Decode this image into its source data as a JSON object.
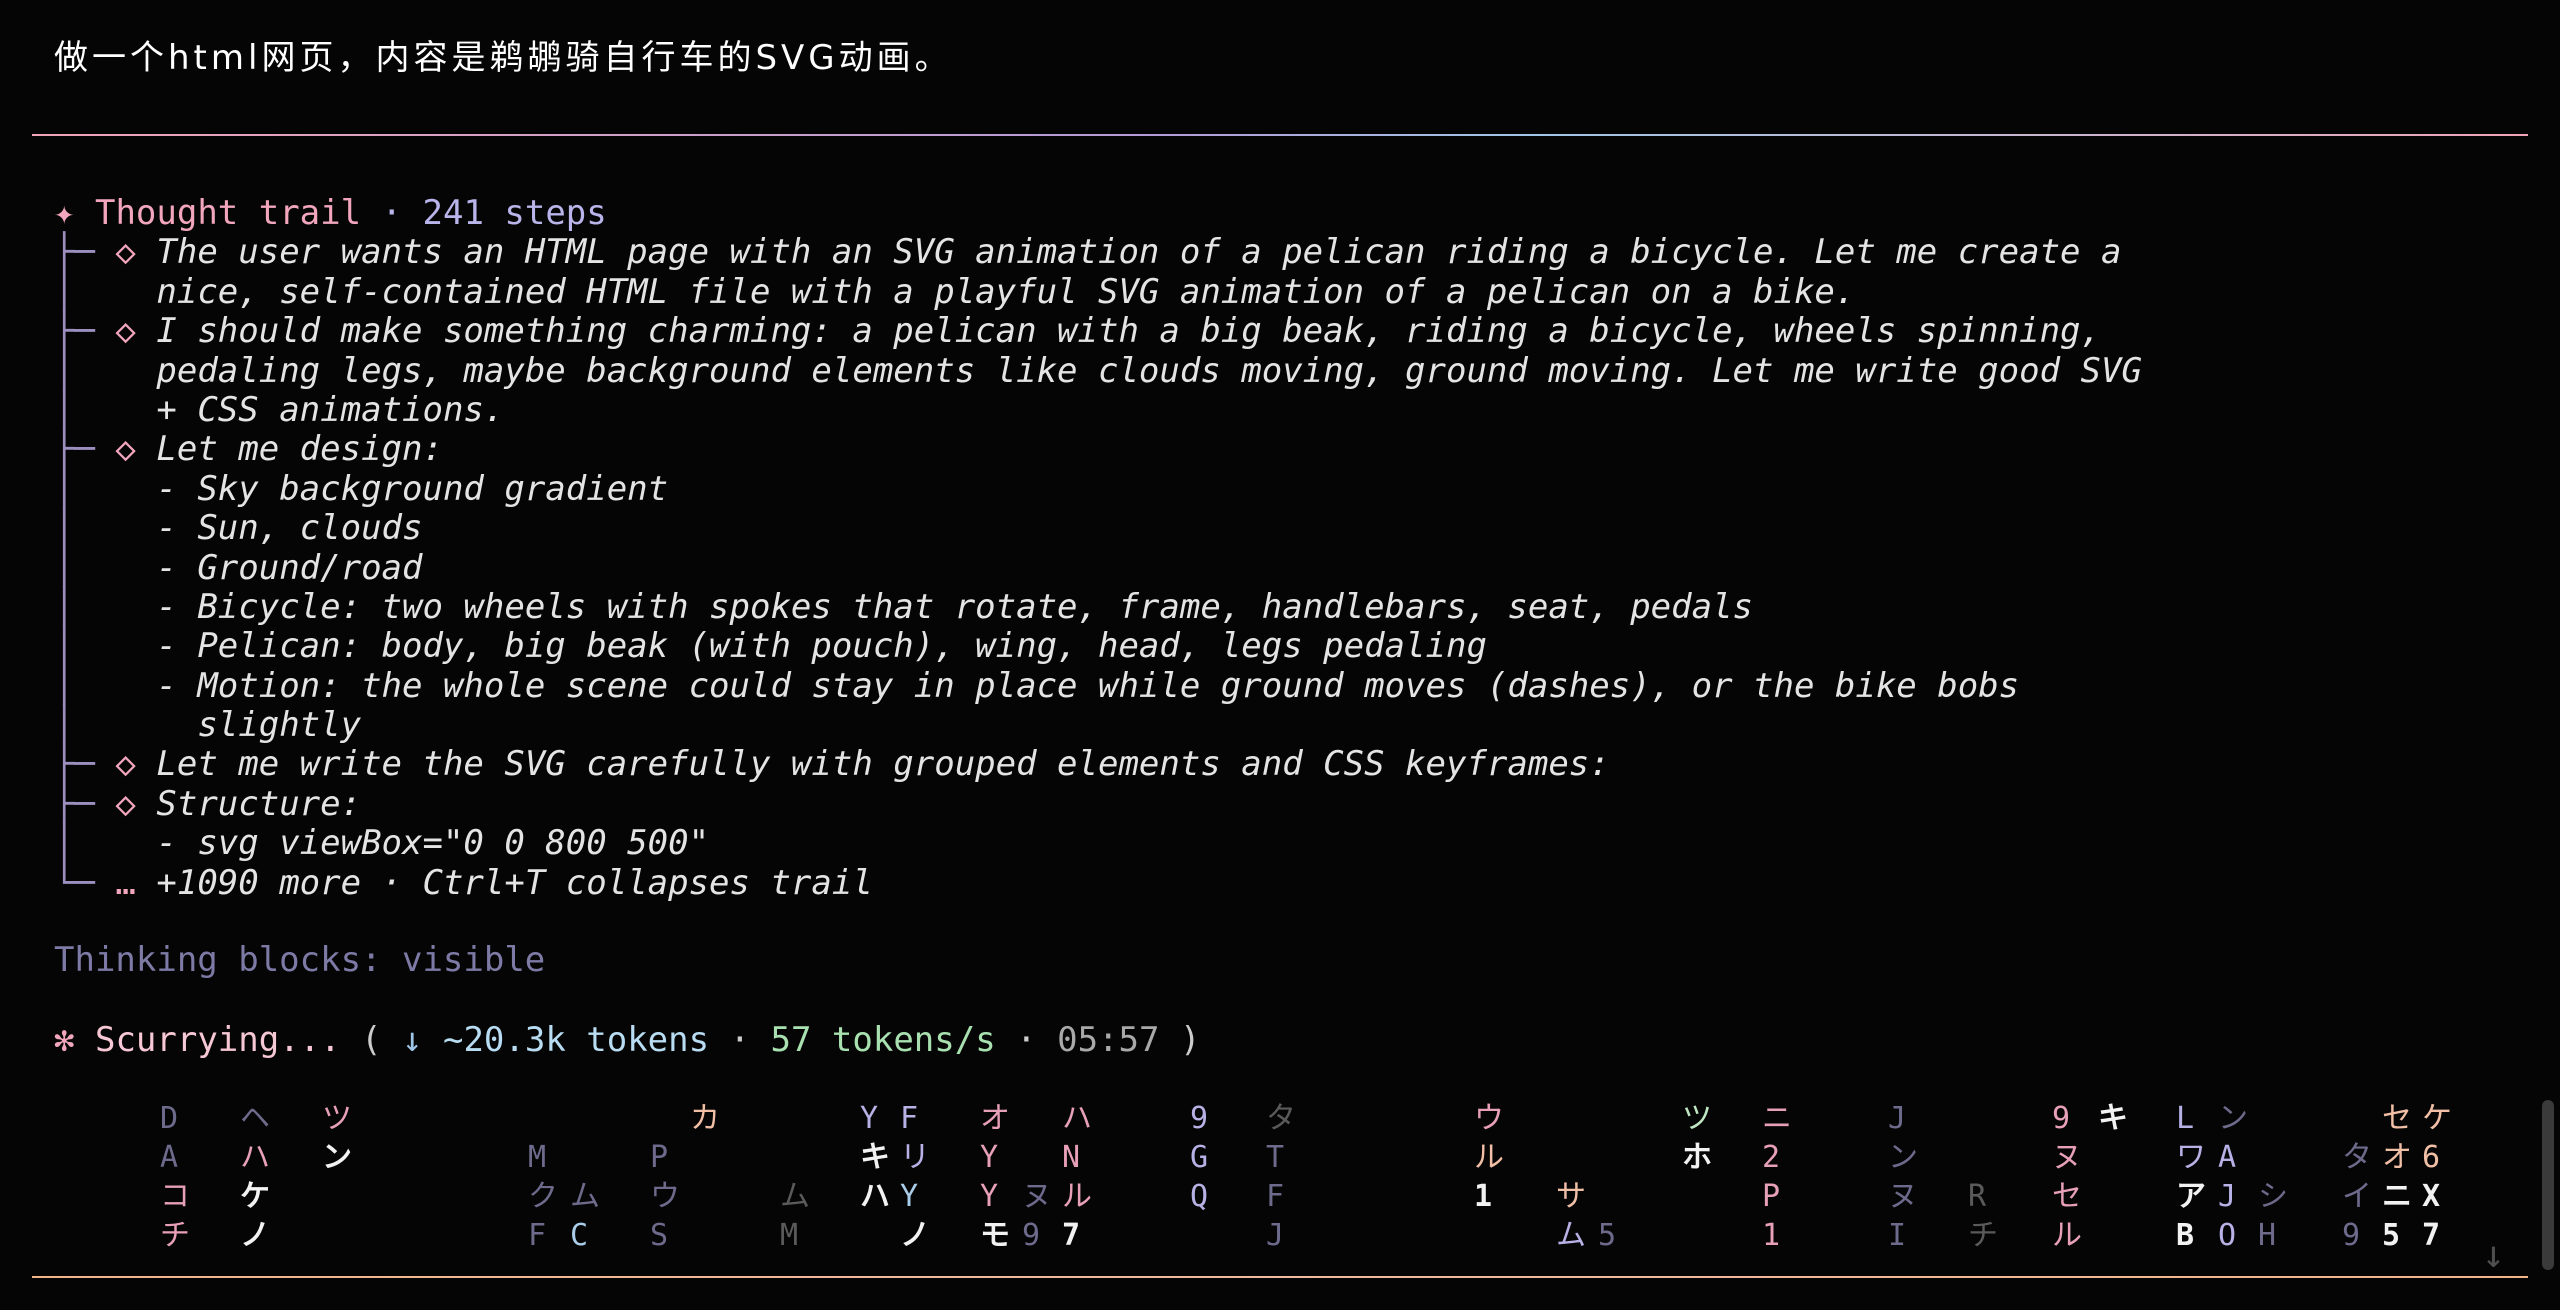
{
  "prompt": "做一个html网页，内容是鹈鹕骑自行车的SVG动画。",
  "trail": {
    "star": "✦",
    "title": "Thought trail",
    "sep": " · ",
    "count": "241 steps",
    "lines": [
      {
        "prefix": "├─ ",
        "marker": "◇ ",
        "text": "The user wants an HTML page with an SVG animation of a pelican riding a bicycle. Let me create a"
      },
      {
        "prefix": "│  ",
        "marker": "  ",
        "text": "nice, self-contained HTML file with a playful SVG animation of a pelican on a bike."
      },
      {
        "prefix": "├─ ",
        "marker": "◇ ",
        "text": "I should make something charming: a pelican with a big beak, riding a bicycle, wheels spinning,"
      },
      {
        "prefix": "│  ",
        "marker": "  ",
        "text": "pedaling legs, maybe background elements like clouds moving, ground moving. Let me write good SVG"
      },
      {
        "prefix": "│  ",
        "marker": "  ",
        "text": "+ CSS animations."
      },
      {
        "prefix": "├─ ",
        "marker": "◇ ",
        "text": "Let me design:"
      },
      {
        "prefix": "│  ",
        "marker": "  ",
        "text": "- Sky background gradient"
      },
      {
        "prefix": "│  ",
        "marker": "  ",
        "text": "- Sun, clouds"
      },
      {
        "prefix": "│  ",
        "marker": "  ",
        "text": "- Ground/road"
      },
      {
        "prefix": "│  ",
        "marker": "  ",
        "text": "- Bicycle: two wheels with spokes that rotate, frame, handlebars, seat, pedals"
      },
      {
        "prefix": "│  ",
        "marker": "  ",
        "text": "- Pelican: body, big beak (with pouch), wing, head, legs pedaling"
      },
      {
        "prefix": "│  ",
        "marker": "  ",
        "text": "- Motion: the whole scene could stay in place while ground moves (dashes), or the bike bobs"
      },
      {
        "prefix": "│  ",
        "marker": "  ",
        "text": "  slightly"
      },
      {
        "prefix": "├─ ",
        "marker": "◇ ",
        "text": "Let me write the SVG carefully with grouped elements and CSS keyframes:"
      },
      {
        "prefix": "├─ ",
        "marker": "◇ ",
        "text": "Structure:"
      },
      {
        "prefix": "│  ",
        "marker": "  ",
        "text": "- svg viewBox=\"0 0 800 500\""
      },
      {
        "prefix": "└─ ",
        "marker": "… ",
        "text": "+1090 more · Ctrl+T collapses trail"
      }
    ]
  },
  "thinking": "Thinking blocks: visible",
  "status": {
    "spinner": "✻",
    "label": "Scurrying...",
    "open": " ( ",
    "arrow": "↓",
    "tokens": " ~20.3k tokens",
    "dot": " · ",
    "rate": "57 tokens/s",
    "time": "05:57",
    "close": " )"
  },
  "rain_colors": {
    "dim": "#6d6a8c",
    "pink": "#e7a0b8",
    "lav": "#b7b1e6",
    "blue": "#a9cde8",
    "white": "#f2f2f2",
    "grey": "#5a5a5a",
    "peach": "#f1bfa6",
    "green": "#bfe6c2"
  },
  "rain": [
    {
      "ch": "D",
      "c": "dim"
    },
    {
      "ch": "A",
      "c": "dim"
    },
    {
      "ch": "コ",
      "c": "pink"
    },
    {
      "ch": "チ",
      "c": "pink"
    },
    {
      "ch": "ヘ",
      "c": "dim"
    },
    {
      "ch": "ハ",
      "c": "pink"
    },
    {
      "ch": "ケ",
      "c": "white"
    },
    {
      "ch": "ノ",
      "c": "white"
    },
    {
      "ch": "ツ",
      "c": "pink"
    },
    {
      "ch": "ン",
      "c": "white"
    },
    {
      "ch": "M",
      "c": "dim"
    },
    {
      "ch": "ク",
      "c": "dim"
    },
    {
      "ch": "F",
      "c": "dim"
    },
    {
      "ch": "ム",
      "c": "dim"
    },
    {
      "ch": "C",
      "c": "blue"
    },
    {
      "ch": "P",
      "c": "dim"
    },
    {
      "ch": "ウ",
      "c": "dim"
    },
    {
      "ch": "S",
      "c": "dim"
    },
    {
      "ch": "カ",
      "c": "peach"
    },
    {
      "ch": "ム",
      "c": "grey"
    },
    {
      "ch": "M",
      "c": "grey"
    },
    {
      "ch": "Y",
      "c": "lav"
    },
    {
      "ch": "キ",
      "c": "white"
    },
    {
      "ch": "ハ",
      "c": "white"
    },
    {
      "ch": "F",
      "c": "lav"
    },
    {
      "ch": "リ",
      "c": "lav"
    },
    {
      "ch": "Y",
      "c": "blue"
    },
    {
      "ch": "ノ",
      "c": "white"
    },
    {
      "ch": "オ",
      "c": "pink"
    },
    {
      "ch": "Y",
      "c": "pink"
    },
    {
      "ch": "Y",
      "c": "pink"
    },
    {
      "ch": "モ",
      "c": "white"
    },
    {
      "ch": "ヌ",
      "c": "dim"
    },
    {
      "ch": "9",
      "c": "dim"
    },
    {
      "ch": "ハ",
      "c": "pink"
    },
    {
      "ch": "N",
      "c": "pink"
    },
    {
      "ch": "ル",
      "c": "pink"
    },
    {
      "ch": "7",
      "c": "white"
    },
    {
      "ch": "9",
      "c": "lav"
    },
    {
      "ch": "G",
      "c": "lav"
    },
    {
      "ch": "Q",
      "c": "lav"
    },
    {
      "ch": "タ",
      "c": "grey"
    },
    {
      "ch": "T",
      "c": "dim"
    },
    {
      "ch": "F",
      "c": "dim"
    },
    {
      "ch": "J",
      "c": "dim"
    },
    {
      "ch": "ウ",
      "c": "pink"
    },
    {
      "ch": "ル",
      "c": "peach"
    },
    {
      "ch": "1",
      "c": "white"
    },
    {
      "ch": "サ",
      "c": "peach"
    },
    {
      "ch": "ム",
      "c": "lav"
    },
    {
      "ch": "5",
      "c": "dim"
    },
    {
      "ch": "ツ",
      "c": "green"
    },
    {
      "ch": "ホ",
      "c": "white"
    },
    {
      "ch": "ニ",
      "c": "pink"
    },
    {
      "ch": "2",
      "c": "pink"
    },
    {
      "ch": "P",
      "c": "pink"
    },
    {
      "ch": "1",
      "c": "pink"
    },
    {
      "ch": "J",
      "c": "dim"
    },
    {
      "ch": "ン",
      "c": "dim"
    },
    {
      "ch": "ヌ",
      "c": "dim"
    },
    {
      "ch": "I",
      "c": "dim"
    },
    {
      "ch": "R",
      "c": "grey"
    },
    {
      "ch": "チ",
      "c": "grey"
    },
    {
      "ch": "9",
      "c": "pink"
    },
    {
      "ch": "ヌ",
      "c": "pink"
    },
    {
      "ch": "セ",
      "c": "pink"
    },
    {
      "ch": "ル",
      "c": "pink"
    },
    {
      "ch": "キ",
      "c": "white"
    },
    {
      "ch": "L",
      "c": "lav"
    },
    {
      "ch": "ワ",
      "c": "lav"
    },
    {
      "ch": "ア",
      "c": "white"
    },
    {
      "ch": "B",
      "c": "white"
    },
    {
      "ch": "ン",
      "c": "dim"
    },
    {
      "ch": "A",
      "c": "lav"
    },
    {
      "ch": "J",
      "c": "lav"
    },
    {
      "ch": "O",
      "c": "lav"
    },
    {
      "ch": "シ",
      "c": "dim"
    },
    {
      "ch": "H",
      "c": "dim"
    },
    {
      "ch": "タ",
      "c": "dim"
    },
    {
      "ch": "イ",
      "c": "dim"
    },
    {
      "ch": "9",
      "c": "dim"
    },
    {
      "ch": "セ",
      "c": "peach"
    },
    {
      "ch": "オ",
      "c": "peach"
    },
    {
      "ch": "ニ",
      "c": "white"
    },
    {
      "ch": "5",
      "c": "white"
    },
    {
      "ch": "ケ",
      "c": "peach"
    },
    {
      "ch": "6",
      "c": "peach"
    },
    {
      "ch": "X",
      "c": "white"
    },
    {
      "ch": "7",
      "c": "white"
    }
  ],
  "scroll_arrow": "↓"
}
